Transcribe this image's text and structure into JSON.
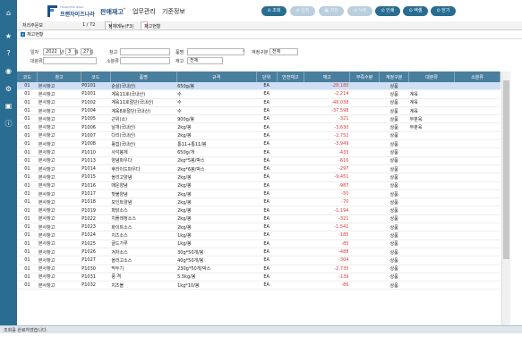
{
  "brand": {
    "name": "프랜차이즈나라",
    "tagline": "FRANCHISE NARA"
  },
  "menu": [
    {
      "label": "판매재고",
      "mark": "*"
    },
    {
      "label": "업무관리",
      "mark": ""
    },
    {
      "label": "기준정보",
      "mark": ""
    }
  ],
  "toolbar": {
    "search": "조회",
    "save": "입력",
    "edit": "저장",
    "del": "삭제",
    "print": "인쇄",
    "excel": "엑셀",
    "close": "닫기"
  },
  "tabs": {
    "left": "처리주문보",
    "page": "1 / 72",
    "tab1": "전체메뉴(F3)",
    "tab2": "재고현황"
  },
  "section": {
    "title": "재고현황"
  },
  "filters": {
    "date_label": "일자",
    "year": "2022",
    "month": "3",
    "day": "27",
    "year_unit": "년",
    "month_unit": "월",
    "day_unit": "일",
    "warehouse_label": "창고",
    "warehouse_value": "",
    "item_label": "품명",
    "item_value": "",
    "account_label": "계정구분",
    "account_value": "전체",
    "major_label": "대분류",
    "major_value": "",
    "minor_label": "소분류",
    "minor_value": "",
    "stock_label": "재고",
    "stock_value": "전체"
  },
  "table": {
    "headers": [
      "코드",
      "창고",
      "코드",
      "품명",
      "규격",
      "단위",
      "안전재고",
      "재고",
      "부족수량",
      "계정구분",
      "대분류",
      "소분류"
    ],
    "rows": [
      [
        "01",
        "본사창고",
        "P0101",
        "순살(국내산)",
        "650g/봉",
        "EA",
        "",
        "-28,180",
        "",
        "상품",
        "",
        ""
      ],
      [
        "01",
        "본사창고",
        "P1001",
        "계육11호(국내산)",
        "수",
        "EA",
        "",
        "-2,214",
        "",
        "상품",
        "계육",
        ""
      ],
      [
        "01",
        "본사창고",
        "P1002",
        "계육11호절단(국내산)",
        "수",
        "EA",
        "",
        "-48,038",
        "",
        "상품",
        "계육",
        ""
      ],
      [
        "01",
        "본사창고",
        "P1004",
        "계육8호절단(국내산)",
        "수",
        "EA",
        "",
        "-37,598",
        "",
        "상품",
        "계육",
        ""
      ],
      [
        "01",
        "본사창고",
        "P1005",
        "근위(소)",
        "900g/봉",
        "EA",
        "",
        "-321",
        "",
        "상품",
        "부분육",
        ""
      ],
      [
        "01",
        "본사창고",
        "P1006",
        "날개(국내산)",
        "2kg/봉",
        "EA",
        "",
        "-3,630",
        "",
        "상품",
        "부분육",
        ""
      ],
      [
        "01",
        "본사창고",
        "P1007",
        "다리(국내산)",
        "2kg/봉",
        "EA",
        "",
        "-2,752",
        "",
        "상품",
        "",
        ""
      ],
      [
        "01",
        "본사창고",
        "P1008",
        "똥집(국내산)",
        "통11+통11/봉",
        "EA",
        "",
        "-3,949",
        "",
        "상품",
        "",
        ""
      ],
      [
        "01",
        "본사창고",
        "P1010",
        "사각봉체",
        "650g/개",
        "EA",
        "",
        "-433",
        "",
        "상품",
        "",
        ""
      ],
      [
        "01",
        "본사창고",
        "P1013",
        "양념파우다",
        "2kg*5봉/박스",
        "EA",
        "",
        "-616",
        "",
        "상품",
        "",
        ""
      ],
      [
        "01",
        "본사창고",
        "P1014",
        "후라이드파우다",
        "2kg*6봉/박스",
        "EA",
        "",
        "-297",
        "",
        "상품",
        "",
        ""
      ],
      [
        "01",
        "본사창고",
        "P1015",
        "올리고양념",
        "2kg/봉",
        "EA",
        "",
        "-9,451",
        "",
        "상품",
        "",
        ""
      ],
      [
        "01",
        "본사창고",
        "P1016",
        "매운양념",
        "2kg/봉",
        "EA",
        "",
        "-987",
        "",
        "상품",
        "",
        ""
      ],
      [
        "01",
        "본사창고",
        "P1017",
        "핫불양념",
        "2kg/봉",
        "EA",
        "",
        "-50",
        "",
        "상품",
        "",
        ""
      ],
      [
        "01",
        "본사창고",
        "P1018",
        "모인트양념",
        "2kg/봉",
        "EA",
        "",
        "-70",
        "",
        "상품",
        "",
        ""
      ],
      [
        "01",
        "본사창고",
        "P1019",
        "파닭소스",
        "2kg/봉",
        "EA",
        "",
        "-1,194",
        "",
        "상품",
        "",
        ""
      ],
      [
        "01",
        "본사창고",
        "P1022",
        "치플레정소스",
        "2kg/봉",
        "EA",
        "",
        "-321",
        "",
        "상품",
        "",
        ""
      ],
      [
        "01",
        "본사창고",
        "P1023",
        "화이트소스",
        "2kg/봉",
        "EA",
        "",
        "-1,541",
        "",
        "상품",
        "",
        ""
      ],
      [
        "01",
        "본사창고",
        "P1024",
        "치즈소스",
        "1kg/봉",
        "EA",
        "",
        "-185",
        "",
        "상품",
        "",
        ""
      ],
      [
        "01",
        "본사창고",
        "P1025",
        "골드가루",
        "1kg/봉",
        "EA",
        "",
        "-85",
        "",
        "상품",
        "",
        ""
      ],
      [
        "01",
        "본사창고",
        "P1026",
        "겨자소스",
        "30g*50개/봉",
        "EA",
        "",
        "-488",
        "",
        "상품",
        "",
        ""
      ],
      [
        "01",
        "본사창고",
        "P1027",
        "올리고소스",
        "40g*50개/봉",
        "EA",
        "",
        "-304",
        "",
        "상품",
        "",
        ""
      ],
      [
        "01",
        "본사창고",
        "P1030",
        "막두기",
        "230g*50개/박스",
        "EA",
        "",
        "-2,735",
        "",
        "상품",
        "",
        ""
      ],
      [
        "01",
        "본사창고",
        "P1031",
        "풍 격",
        "5.5kg/봉",
        "EA",
        "",
        "-139",
        "",
        "상품",
        "",
        ""
      ],
      [
        "01",
        "본사창고",
        "P1032",
        "치즈볼",
        "1kg*10/봉",
        "EA",
        "",
        "-86",
        "",
        "상품",
        "",
        ""
      ]
    ]
  },
  "status": {
    "text": "조회를 완료하였습니다."
  },
  "colors": {
    "header_bg": "#4a7e9e",
    "selected_row": "#cfe0f6",
    "negative": "#e03a3a",
    "sidebar": "#2a6d92"
  }
}
